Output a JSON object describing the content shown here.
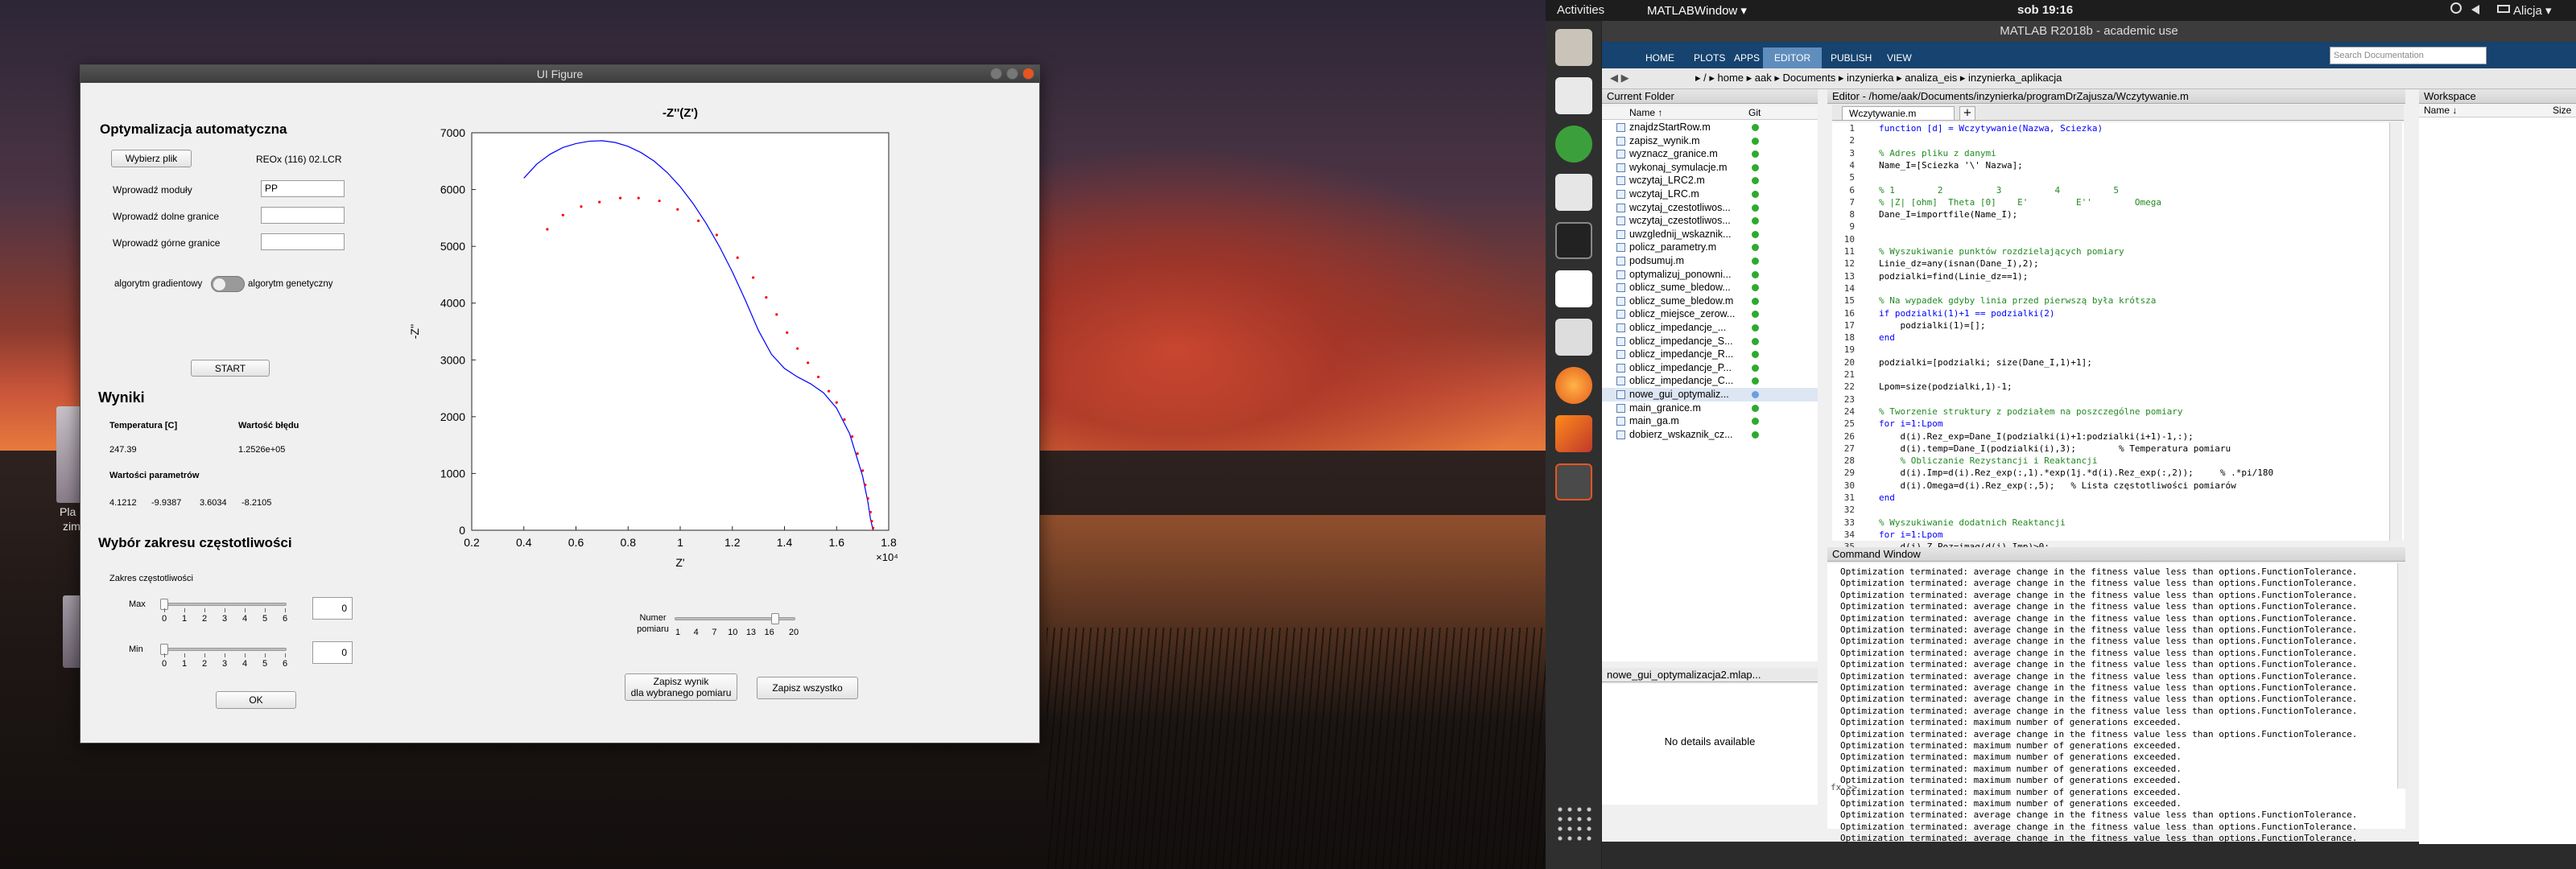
{
  "topbar": {
    "activities": "Activities",
    "app": "MATLABWindow ▾",
    "clock": "sob 19:16",
    "user": "Alicja ▾"
  },
  "desktop": {
    "icon_label_1": "Pla",
    "icon_label_2": "zim"
  },
  "uifigure": {
    "title": "UI Figure",
    "section_opt": "Optymalizacja automatyczna",
    "choose_file_btn": "Wybierz plik",
    "file_name": "REOx (116) 02.LCR",
    "module_label": "Wprowadź moduły",
    "module_value": "PP",
    "lower_label": "Wprowadź dolne granice",
    "upper_label": "Wprowadź górne granice",
    "toggle_left": "algorytm gradientowy",
    "toggle_right": "algorytm genetyczny",
    "start_btn": "START",
    "results_title": "Wyniki",
    "temp_header": "Temperatura [C]",
    "err_header": "Wartość błędu",
    "temp_value": "247.39",
    "err_value": "1.2526e+05",
    "params_header": "Wartości parametrów",
    "params": [
      "4.1212",
      "-9.9387",
      "3.6034",
      "-8.2105"
    ],
    "freq_title": "Wybór zakresu częstotliwości",
    "freq_range_label": "Zakres częstotliwości",
    "max_label": "Max",
    "min_label": "Min",
    "max_value": "0",
    "min_value": "0",
    "slider_ticks": [
      "0",
      "1",
      "2",
      "3",
      "4",
      "5",
      "6"
    ],
    "ok_btn": "OK",
    "measure_label_1": "Numer",
    "measure_label_2": "pomiaru",
    "measure_ticks": [
      "1",
      "4",
      "7",
      "10",
      "13",
      "16",
      "20"
    ],
    "measure_value": 17,
    "save_one_btn_1": "Zapisz wynik",
    "save_one_btn_2": "dla wybranego pomiaru",
    "save_all_btn": "Zapisz wszystko"
  },
  "chart_data": {
    "type": "scatter",
    "title": "-Z''(Z')",
    "xlabel": "Z'",
    "ylabel": "-Z''",
    "x_multiplier": "×10⁴",
    "xlim": [
      0.2,
      1.8
    ],
    "ylim": [
      0,
      7000
    ],
    "xticks": [
      "0.2",
      "0.4",
      "0.6",
      "0.8",
      "1",
      "1.2",
      "1.4",
      "1.6",
      "1.8"
    ],
    "yticks": [
      "0",
      "1000",
      "2000",
      "3000",
      "4000",
      "5000",
      "6000",
      "7000"
    ],
    "series": [
      {
        "style": "line",
        "color": "#0000ff",
        "x": [
          0.4,
          0.45,
          0.5,
          0.55,
          0.6,
          0.65,
          0.7,
          0.75,
          0.8,
          0.85,
          0.9,
          0.95,
          1.0,
          1.05,
          1.1,
          1.15,
          1.2,
          1.25,
          1.3,
          1.35,
          1.4,
          1.45,
          1.5,
          1.55,
          1.6,
          1.65,
          1.7,
          1.72,
          1.73,
          1.74
        ],
        "y": [
          6200,
          6450,
          6620,
          6740,
          6810,
          6850,
          6860,
          6830,
          6760,
          6650,
          6500,
          6300,
          6050,
          5750,
          5400,
          5000,
          4550,
          4050,
          3520,
          3100,
          2850,
          2700,
          2580,
          2420,
          2150,
          1700,
          950,
          500,
          200,
          0
        ]
      },
      {
        "style": "markers",
        "color": "#ff0000",
        "x": [
          0.49,
          0.55,
          0.62,
          0.69,
          0.77,
          0.84,
          0.92,
          0.99,
          1.07,
          1.14,
          1.22,
          1.28,
          1.33,
          1.37,
          1.41,
          1.45,
          1.49,
          1.53,
          1.57,
          1.6,
          1.63,
          1.66,
          1.68,
          1.7,
          1.71,
          1.72,
          1.73,
          1.735,
          1.74
        ],
        "y": [
          5300,
          5550,
          5700,
          5780,
          5850,
          5850,
          5800,
          5650,
          5450,
          5200,
          4800,
          4450,
          4100,
          3800,
          3480,
          3200,
          2950,
          2700,
          2450,
          2250,
          1950,
          1650,
          1350,
          1050,
          800,
          560,
          320,
          160,
          40
        ]
      }
    ]
  },
  "matlab": {
    "title": "MATLAB R2018b - academic use",
    "tabs": [
      "HOME",
      "PLOTS",
      "APPS",
      "EDITOR",
      "PUBLISH",
      "VIEW"
    ],
    "search_placeholder": "Search Documentation",
    "path": "▸ / ▸ home ▸ aak ▸ Documents ▸ inzynierka ▸ analiza_eis ▸ inzynierka_aplikacja",
    "current_folder_title": "Current Folder",
    "col_name": "Name ↑",
    "col_git": "Git",
    "files": [
      "znajdzStartRow.m",
      "zapisz_wynik.m",
      "wyznacz_granice.m",
      "wykonaj_symulacje.m",
      "wczytaj_LRC2.m",
      "wczytaj_LRC.m",
      "wczytaj_czestotliwos...",
      "wczytaj_czestotliwos...",
      "uwzglednij_wskaznik...",
      "policz_parametry.m",
      "podsumuj.m",
      "optymalizuj_ponowni...",
      "oblicz_sume_bledow...",
      "oblicz_sume_bledow.m",
      "oblicz_miejsce_zerow...",
      "oblicz_impedancje_...",
      "oblicz_impedancje_S...",
      "oblicz_impedancje_R...",
      "oblicz_impedancje_P...",
      "oblicz_impedancje_C...",
      "nowe_gui_optymaliz...",
      "main_granice.m",
      "main_ga.m",
      "dobierz_wskaznik_cz..."
    ],
    "details_title": "nowe_gui_optymalizacja2.mlap...",
    "details_text": "No details available",
    "editor_title": "Editor - /home/aak/Documents/inzynierka/programDrZajusza/Wczytywanie.m",
    "editor_tab": "Wczytywanie.m",
    "workspace_title": "Workspace",
    "workspace_col_name": "Name ↓",
    "workspace_col_size": "Size",
    "command_title": "Command Window",
    "prompt": "fx >>",
    "code": [
      {
        "t": "function [d] = Wczytywanie(Nazwa, Sciezka)",
        "c": "kw"
      },
      {
        "t": "",
        "c": ""
      },
      {
        "t": "% Adres pliku z danymi",
        "c": "cm"
      },
      {
        "t": "Name_I=[Sciezka '\\' Nazwa];",
        "c": ""
      },
      {
        "t": "",
        "c": ""
      },
      {
        "t": "% 1        2          3          4          5",
        "c": "cm"
      },
      {
        "t": "% |Z| [ohm]  Theta [0]    E'         E''        Omega",
        "c": "cm"
      },
      {
        "t": "Dane_I=importfile(Name_I);",
        "c": ""
      },
      {
        "t": "",
        "c": ""
      },
      {
        "t": "",
        "c": ""
      },
      {
        "t": "% Wyszukiwanie punktów rozdzielających pomiary",
        "c": "cm"
      },
      {
        "t": "Linie_dz=any(isnan(Dane_I),2);",
        "c": ""
      },
      {
        "t": "podzialki=find(Linie_dz==1);",
        "c": ""
      },
      {
        "t": "",
        "c": ""
      },
      {
        "t": "% Na wypadek gdyby linia przed pierwszą była krótsza",
        "c": "cm"
      },
      {
        "t": "if podzialki(1)+1 == podzialki(2)",
        "c": "kw"
      },
      {
        "t": "    podzialki(1)=[];",
        "c": ""
      },
      {
        "t": "end",
        "c": "kw"
      },
      {
        "t": "",
        "c": ""
      },
      {
        "t": "podzialki=[podzialki; size(Dane_I,1)+1];",
        "c": ""
      },
      {
        "t": "",
        "c": ""
      },
      {
        "t": "Lpom=size(podzialki,1)-1;",
        "c": ""
      },
      {
        "t": "",
        "c": ""
      },
      {
        "t": "% Tworzenie struktury z podziałem na poszczególne pomiary",
        "c": "cm"
      },
      {
        "t": "for i=1:Lpom",
        "c": "kw"
      },
      {
        "t": "    d(i).Rez_exp=Dane_I(podzialki(i)+1:podzialki(i+1)-1,:);",
        "c": ""
      },
      {
        "t": "    d(i).temp=Dane_I(podzialki(i),3);        % Temperatura pomiaru",
        "c": ""
      },
      {
        "t": "    % Obliczanie Rezystancji i Reaktancji",
        "c": "cm"
      },
      {
        "t": "    d(i).Imp=d(i).Rez_exp(:,1).*exp(1j.*d(i).Rez_exp(:,2));     % .*pi/180",
        "c": ""
      },
      {
        "t": "    d(i).Omega=d(i).Rez_exp(:,5);   % Lista częstotliwości pomiarów",
        "c": ""
      },
      {
        "t": "end",
        "c": "kw"
      },
      {
        "t": "",
        "c": ""
      },
      {
        "t": "% Wyszukiwanie dodatnich Reaktancji",
        "c": "cm"
      },
      {
        "t": "for i=1:Lpom",
        "c": "kw"
      },
      {
        "t": "    d(i).Z_Poz=imag(d(i).Imp)>0;",
        "c": ""
      }
    ],
    "cmd_lines": [
      "Optimization terminated: average change in the fitness value less than options.FunctionTolerance.",
      "Optimization terminated: average change in the fitness value less than options.FunctionTolerance.",
      "Optimization terminated: average change in the fitness value less than options.FunctionTolerance.",
      "Optimization terminated: average change in the fitness value less than options.FunctionTolerance.",
      "Optimization terminated: average change in the fitness value less than options.FunctionTolerance.",
      "Optimization terminated: average change in the fitness value less than options.FunctionTolerance.",
      "Optimization terminated: average change in the fitness value less than options.FunctionTolerance.",
      "Optimization terminated: average change in the fitness value less than options.FunctionTolerance.",
      "Optimization terminated: average change in the fitness value less than options.FunctionTolerance.",
      "Optimization terminated: average change in the fitness value less than options.FunctionTolerance.",
      "Optimization terminated: average change in the fitness value less than options.FunctionTolerance.",
      "Optimization terminated: average change in the fitness value less than options.FunctionTolerance.",
      "Optimization terminated: average change in the fitness value less than options.FunctionTolerance.",
      "Optimization terminated: maximum number of generations exceeded.",
      "Optimization terminated: average change in the fitness value less than options.FunctionTolerance.",
      "Optimization terminated: maximum number of generations exceeded.",
      "Optimization terminated: maximum number of generations exceeded.",
      "Optimization terminated: maximum number of generations exceeded.",
      "Optimization terminated: maximum number of generations exceeded.",
      "Optimization terminated: maximum number of generations exceeded.",
      "Optimization terminated: maximum number of generations exceeded.",
      "Optimization terminated: average change in the fitness value less than options.FunctionTolerance.",
      "Optimization terminated: average change in the fitness value less than options.FunctionTolerance.",
      "Optimization terminated: average change in the fitness value less than options.FunctionTolerance."
    ]
  }
}
